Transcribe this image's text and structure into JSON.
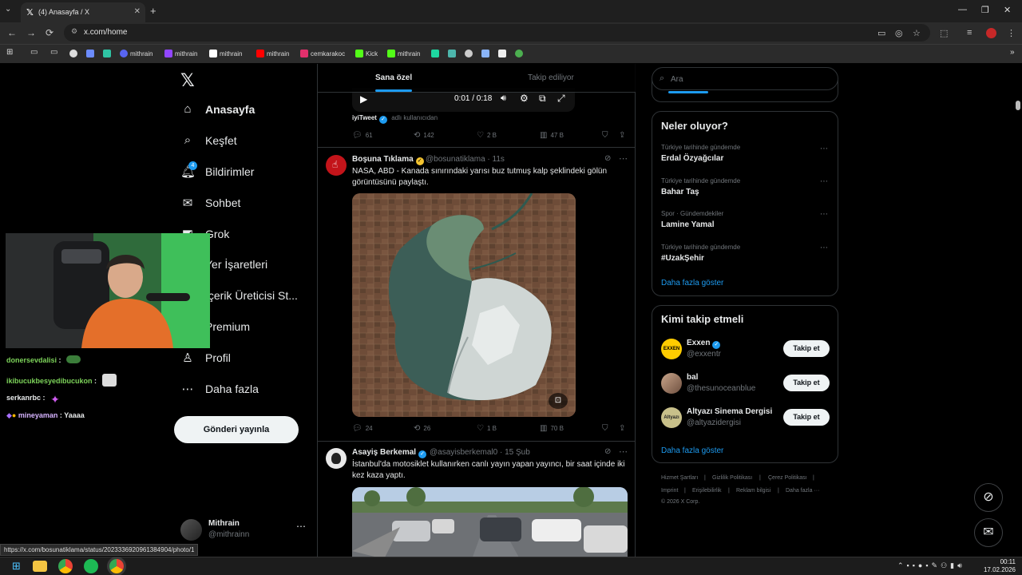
{
  "browser": {
    "tab_title": "(4) Anasayfa / X",
    "url": "x.com/home",
    "status_url": "https://x.com/bosunatiklama/status/2023336920961384904/photo/1",
    "bookmarks": [
      {
        "label": "mithrain",
        "color": "#5865f2"
      },
      {
        "label": "mithrain",
        "color": "#9146ff"
      },
      {
        "label": "mithrain",
        "color": "#ffffff"
      },
      {
        "label": "mithrain",
        "color": "#ff0000"
      },
      {
        "label": "cemkarakoc",
        "color": "#e1306c"
      },
      {
        "label": "Kick",
        "color": "#53fc18"
      },
      {
        "label": "mithrain",
        "color": "#53fc18"
      }
    ]
  },
  "nav": {
    "items": [
      {
        "label": "Anasayfa",
        "icon": "home-icon"
      },
      {
        "label": "Keşfet",
        "icon": "search-icon"
      },
      {
        "label": "Bildirimler",
        "icon": "bell-icon",
        "badge": "4"
      },
      {
        "label": "Sohbet",
        "icon": "mail-icon"
      },
      {
        "label": "Grok",
        "icon": "grok-icon"
      },
      {
        "label": "Yer İşaretleri",
        "icon": "bookmark-icon"
      },
      {
        "label": "İçerik Üreticisi St...",
        "icon": "creator-icon"
      },
      {
        "label": "Premium",
        "icon": "premium-icon"
      },
      {
        "label": "Profil",
        "icon": "person-icon"
      },
      {
        "label": "Daha fazla",
        "icon": "more-circle-icon"
      }
    ],
    "post_button": "Gönderi yayınla",
    "profile": {
      "name": "Mithrain",
      "handle": "@mithrainn"
    }
  },
  "chat": [
    {
      "user": "donersevdalisi",
      "msg": ":",
      "color": "#7dd35a"
    },
    {
      "user": "ikibucukbesyedibucukon",
      "msg": ":",
      "color": "#7dd35a"
    },
    {
      "user": "serkanrbc",
      "msg": ":",
      "color": "#e7e9ea"
    },
    {
      "user": "mineyaman",
      "msg": ": Yaaaa",
      "color": "#d6b3ff"
    }
  ],
  "feed": {
    "tabs": [
      "Sana özel",
      "Takip ediliyor"
    ],
    "video": {
      "time": "0:01 / 0:18"
    },
    "prev_tweet": {
      "source": "iyiTweet",
      "source_suffix": "adlı kullanıcıdan",
      "replies": "61",
      "reposts": "142",
      "likes": "2 B",
      "views": "47 B"
    },
    "tweet1": {
      "name": "Boşuna Tıklama",
      "handle": "@bosunatiklama · 11s",
      "text": "NASA, ABD - Kanada sınırındaki yarısı buz tutmuş kalp şeklindeki gölün görüntüsünü paylaştı.",
      "replies": "24",
      "reposts": "26",
      "likes": "1 B",
      "views": "70 B"
    },
    "tweet2": {
      "name": "Asayiş Berkemal",
      "handle": "@asayisberkemal0 · 15 Şub",
      "text": "İstanbul'da motosiklet kullanırken canlı yayın yapan yayıncı, bir saat içinde iki kez kaza yaptı."
    }
  },
  "right": {
    "search_placeholder": "Ara",
    "trends_title": "Neler oluyor?",
    "trends": [
      {
        "category": "Türkiye tarihinde gündemde",
        "name": "Erdal Özyağcılar"
      },
      {
        "category": "Türkiye tarihinde gündemde",
        "name": "Bahar Taş"
      },
      {
        "category": "Spor · Gündemdekiler",
        "name": "Lamine Yamal"
      },
      {
        "category": "Türkiye tarihinde gündemde",
        "name": "#UzakŞehir"
      }
    ],
    "trends_more": "Daha fazla göster",
    "who_title": "Kimi takip etmeli",
    "who": [
      {
        "name": "Exxen",
        "handle": "@exxentr",
        "verified": true,
        "follow": "Takip et"
      },
      {
        "name": "bal",
        "handle": "@thesunoceanblue",
        "verified": false,
        "follow": "Takip et"
      },
      {
        "name": "Altyazı Sinema Dergisi",
        "handle": "@altyazidergisi",
        "verified": false,
        "follow": "Takip et"
      }
    ],
    "who_more": "Daha fazla göster",
    "footer": [
      "Hizmet Şartları",
      "|",
      "Gizlilik Politikası",
      "|",
      "Çerez Politikası",
      "|",
      "Imprint",
      "|",
      "Erişilebilirlik",
      "|",
      "Reklam bilgisi",
      "|",
      "Daha fazla ···",
      "© 2026 X Corp."
    ]
  },
  "taskbar": {
    "time": "00:11",
    "date": "17.02.2026"
  }
}
